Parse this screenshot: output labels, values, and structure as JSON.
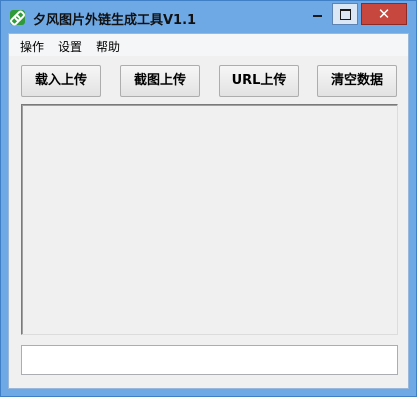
{
  "window": {
    "title": "夕风图片外链生成工具V1.1",
    "icon": "link-icon",
    "close_glyph": "✕"
  },
  "menu": {
    "items": [
      "操作",
      "设置",
      "帮助"
    ]
  },
  "toolbar": {
    "load_upload": "载入上传",
    "screenshot_upload": "截图上传",
    "url_upload": "URL上传",
    "clear_data": "清空数据"
  },
  "url_field": {
    "value": "",
    "placeholder": ""
  },
  "colors": {
    "titlebar": "#6ea9e6",
    "close_button": "#c7463d",
    "client_bg": "#f0f0f0"
  }
}
